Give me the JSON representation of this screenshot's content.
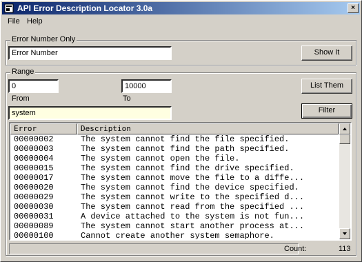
{
  "window": {
    "title": "API Error Description Locator 3.0a"
  },
  "menu": [
    "File",
    "Help"
  ],
  "error_number": {
    "legend": "Error Number Only",
    "value": "Error Number",
    "button": "Show It"
  },
  "range": {
    "legend": "Range",
    "from_value": "0",
    "from_label": "From",
    "to_value": "10000",
    "to_label": "To",
    "list_button": "List Them",
    "filter_value": "system",
    "filter_button": "Filter"
  },
  "table": {
    "columns": [
      "Error",
      "Description"
    ],
    "rows": [
      [
        "00000002",
        "The system cannot find the file specified."
      ],
      [
        "00000003",
        "The system cannot find the path specified."
      ],
      [
        "00000004",
        "The system cannot open the file."
      ],
      [
        "00000015",
        "The system cannot find the drive specified."
      ],
      [
        "00000017",
        "The system cannot move the file to a diffe..."
      ],
      [
        "00000020",
        "The system cannot find the device specified."
      ],
      [
        "00000029",
        "The system cannot write to the specified d..."
      ],
      [
        "00000030",
        "The system cannot read from the specified ..."
      ],
      [
        "00000031",
        "A device attached to the system is not fun..."
      ],
      [
        "00000089",
        "The system cannot start another process at..."
      ],
      [
        "00000100",
        "Cannot create another system semaphore."
      ]
    ]
  },
  "status": {
    "count_label": "Count:",
    "count_value": "113"
  },
  "colors": {
    "title_start": "#0a246a",
    "title_end": "#a6caf0",
    "filter_bg": "#ffffe1",
    "face": "#d4d0c8"
  }
}
